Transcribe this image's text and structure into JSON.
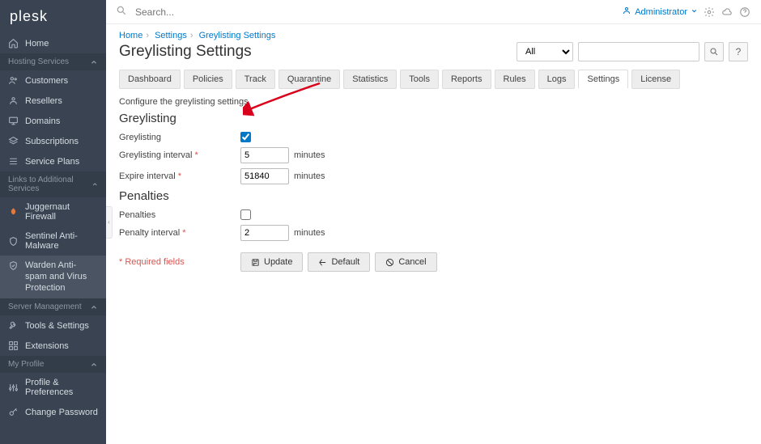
{
  "brand": "plesk",
  "search_placeholder": "Search...",
  "user": {
    "name": "Administrator"
  },
  "sidebar": {
    "home": "Home",
    "sections": {
      "hosting": "Hosting Services",
      "links": "Links to Additional Services",
      "server": "Server Management",
      "profile": "My Profile"
    },
    "items": {
      "customers": "Customers",
      "resellers": "Resellers",
      "domains": "Domains",
      "subscriptions": "Subscriptions",
      "service_plans": "Service Plans",
      "juggernaut": "Juggernaut Firewall",
      "sentinel": "Sentinel Anti-Malware",
      "warden": "Warden Anti-spam and Virus Protection",
      "tools": "Tools & Settings",
      "extensions": "Extensions",
      "profile_prefs": "Profile & Preferences",
      "change_pw": "Change Password"
    }
  },
  "breadcrumbs": {
    "home": "Home",
    "settings": "Settings",
    "current": "Greylisting Settings"
  },
  "page_title": "Greylisting Settings",
  "toolbar": {
    "filter_selected": "All"
  },
  "tabs": [
    "Dashboard",
    "Policies",
    "Track",
    "Quarantine",
    "Statistics",
    "Tools",
    "Reports",
    "Rules",
    "Logs",
    "Settings",
    "License"
  ],
  "active_tab": "Settings",
  "description": "Configure the greylisting settings.",
  "sections_h": {
    "greylisting": "Greylisting",
    "penalties": "Penalties"
  },
  "fields": {
    "greylisting": {
      "label": "Greylisting",
      "checked": true
    },
    "greylisting_interval": {
      "label": "Greylisting interval",
      "value": "5",
      "unit": "minutes"
    },
    "expire_interval": {
      "label": "Expire interval",
      "value": "51840",
      "unit": "minutes"
    },
    "penalties": {
      "label": "Penalties",
      "checked": false
    },
    "penalty_interval": {
      "label": "Penalty interval",
      "value": "2",
      "unit": "minutes"
    }
  },
  "required_note": "* Required fields",
  "buttons": {
    "update": "Update",
    "default": "Default",
    "cancel": "Cancel"
  }
}
